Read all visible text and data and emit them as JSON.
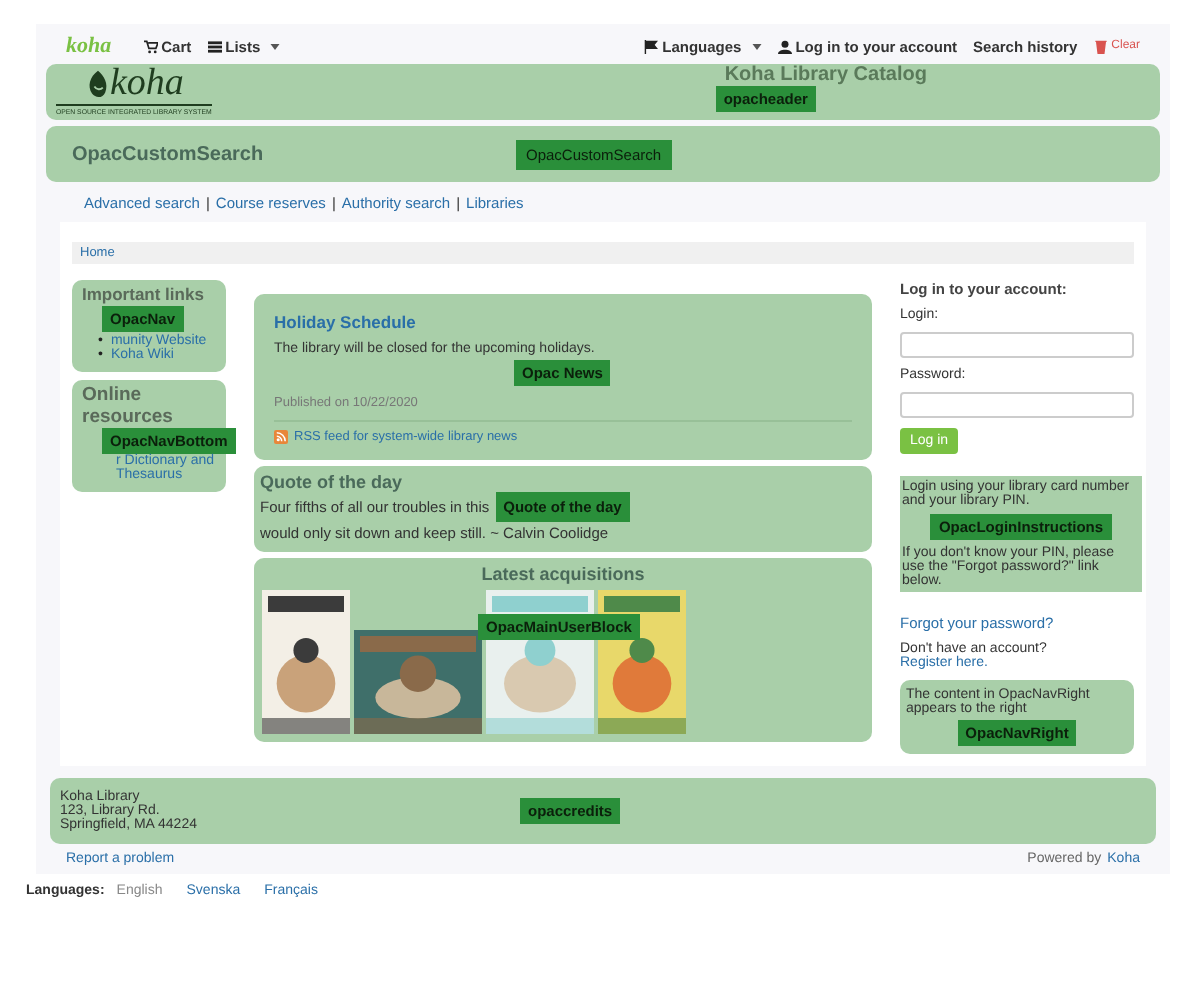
{
  "topbar": {
    "logo": "koha",
    "cart": "Cart",
    "lists": "Lists",
    "languages": "Languages",
    "login": "Log in to your account",
    "search_history": "Search history",
    "clear": "Clear"
  },
  "header": {
    "logo_word": "koha",
    "tagline": "OPEN SOURCE INTEGRATED LIBRARY SYSTEM",
    "title": "Koha Library Catalog",
    "region_label": "opacheader"
  },
  "custom_search": {
    "text": "OpacCustomSearch",
    "region_label": "OpacCustomSearch"
  },
  "nav_links": [
    "Advanced search",
    "Course reserves",
    "Authority search",
    "Libraries"
  ],
  "nav_separator": "|",
  "breadcrumb": "Home",
  "opac_nav": {
    "heading": "Important links",
    "region_label": "OpacNav",
    "bullet": "•",
    "items": [
      "munity Website",
      "Koha Wiki"
    ]
  },
  "opac_nav_bottom": {
    "heading": "Online resources",
    "region_label": "OpacNavBottom",
    "items": [
      "r Dictionary and Thesaurus"
    ]
  },
  "news": {
    "title": "Holiday Schedule",
    "body": "The library will be closed for the upcoming holidays.",
    "published": "Published on 10/22/2020",
    "rss": "RSS feed for system-wide library news",
    "region_label": "Opac News"
  },
  "quote": {
    "heading": "Quote of the day",
    "before": "Four fifths of all our troubles in this",
    "after": "would only sit down and keep still. ~ Calvin Coolidge",
    "region_label": "Quote of the day"
  },
  "acquisitions": {
    "heading": "Latest acquisitions",
    "region_label": "OpacMainUserBlock"
  },
  "login": {
    "heading": "Log in to your account:",
    "login_label": "Login:",
    "password_label": "Password:",
    "button": "Log in",
    "instructions_before": "Login using your library card number and your library PIN.",
    "instructions_label": "OpacLoginInstructions",
    "instructions_after": "If you don't know your PIN, please use the \"Forgot password?\" link below.",
    "forgot": "Forgot your password?",
    "register_prompt": "Don't have an account?",
    "register_link": "Register here.",
    "nav_right_text": "The content in OpacNavRight appears to the right",
    "nav_right_label": "OpacNavRight"
  },
  "credits": {
    "lines": [
      "Koha Library",
      "123, Library Rd.",
      "Springfield, MA 44224"
    ],
    "region_label": "opaccredits"
  },
  "footer": {
    "report": "Report a problem",
    "powered": "Powered by",
    "powered_link": "Koha"
  },
  "languages": {
    "label": "Languages:",
    "items": [
      {
        "name": "English",
        "selected": true
      },
      {
        "name": "Svenska",
        "selected": false
      },
      {
        "name": "Français",
        "selected": false
      }
    ]
  }
}
